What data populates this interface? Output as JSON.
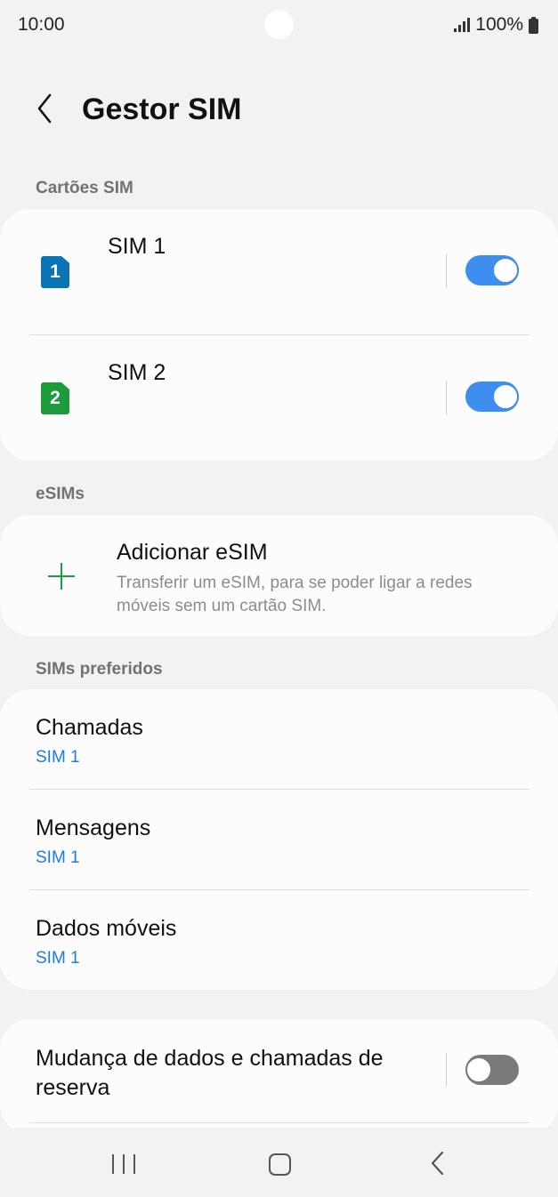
{
  "status_bar": {
    "time": "10:00",
    "battery": "100%"
  },
  "header": {
    "title": "Gestor SIM"
  },
  "sections": {
    "sim_cards": "Cartões SIM",
    "esims": "eSIMs",
    "preferred": "SIMs preferidos"
  },
  "sim_cards": [
    {
      "label": "SIM 1",
      "badge": "1",
      "color": "#0a74b5",
      "enabled": true
    },
    {
      "label": "SIM 2",
      "badge": "2",
      "color": "#1d9a3a",
      "enabled": true
    }
  ],
  "esim": {
    "title": "Adicionar eSIM",
    "description": "Transferir um eSIM, para se poder ligar a redes móveis sem um cartão SIM."
  },
  "preferred": [
    {
      "title": "Chamadas",
      "value": "SIM 1"
    },
    {
      "title": "Mensagens",
      "value": "SIM 1"
    },
    {
      "title": "Dados móveis",
      "value": "SIM 1"
    }
  ],
  "backup": {
    "label": "Mudança de dados e chamadas de reserva",
    "enabled": false
  },
  "colors": {
    "accent": "#3e8ef0",
    "link": "#1f7cdf",
    "add_icon": "#1a9e43"
  },
  "icons": [
    "back-arrow-icon",
    "plus-icon",
    "signal-icon",
    "battery-icon",
    "recent-apps-icon",
    "home-icon",
    "nav-back-icon"
  ]
}
